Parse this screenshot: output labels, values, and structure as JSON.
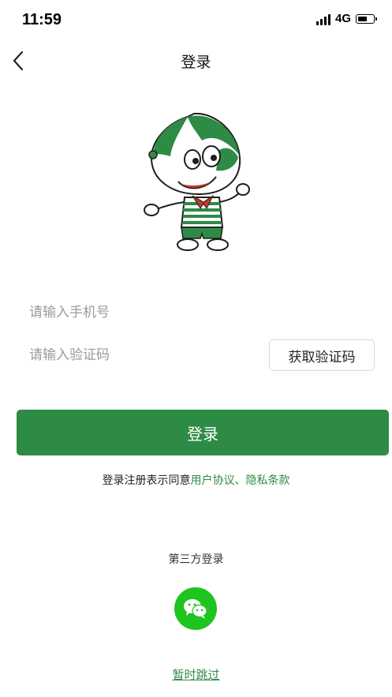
{
  "status_bar": {
    "time": "11:59",
    "network": "4G",
    "battery_level": 0.6
  },
  "nav": {
    "title": "登录",
    "back_icon": "chevron-left-icon"
  },
  "mascot": {
    "icon": "mascot-character-icon"
  },
  "form": {
    "phone_placeholder": "请输入手机号",
    "phone_value": "",
    "code_placeholder": "请输入验证码",
    "code_value": "",
    "get_code_label": "获取验证码",
    "login_label": "登录"
  },
  "agreement": {
    "prefix": "登录注册表示同意",
    "terms_link": "用户协议",
    "separator": "、",
    "privacy_link": "隐私条款"
  },
  "third_party": {
    "title": "第三方登录",
    "wechat_icon": "wechat-icon"
  },
  "skip": {
    "label": "暂时跳过"
  },
  "colors": {
    "primary": "#2e8b45",
    "wechat": "#1fc41f"
  }
}
